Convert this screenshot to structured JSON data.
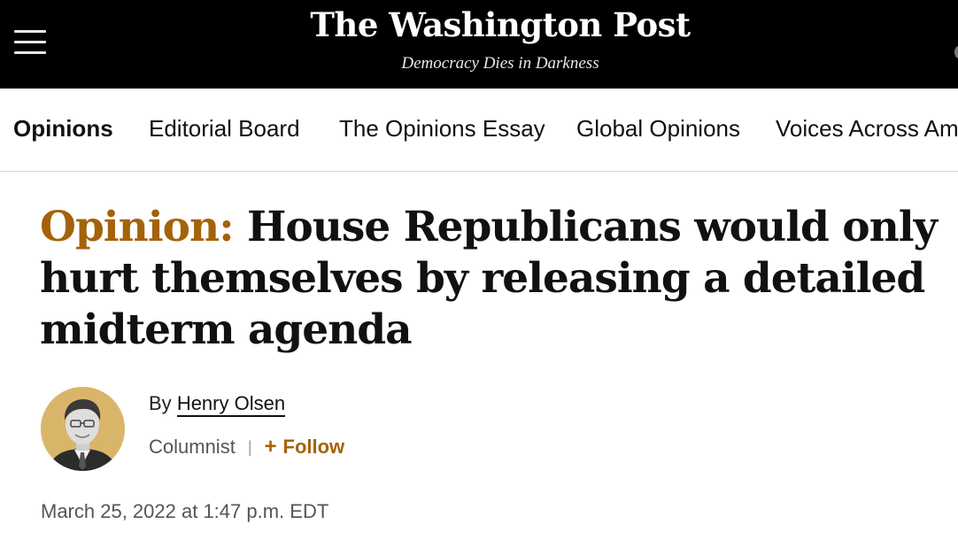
{
  "masthead": {
    "logo_text": "The Washington Post",
    "tagline": "Democracy Dies in Darkness"
  },
  "section_nav": {
    "items": [
      {
        "label": "Opinions",
        "active": true
      },
      {
        "label": "Editorial Board",
        "active": false
      },
      {
        "label": "The Opinions Essay",
        "active": false
      },
      {
        "label": "Global Opinions",
        "active": false
      },
      {
        "label": "Voices Across Am",
        "active": false
      }
    ]
  },
  "article": {
    "kicker": "Opinion:",
    "title": "House Republicans would only hurt themselves by releasing a detailed midterm agenda",
    "byline_prefix": "By",
    "author": "Henry Olsen",
    "author_role": "Columnist",
    "separator": "|",
    "follow_label": "Follow",
    "published": "March 25, 2022 at 1:47 p.m. EDT"
  },
  "colors": {
    "accent": "#a4620a",
    "masthead_bg": "#000000",
    "avatar_bg": "#d9b56a"
  },
  "icons": {
    "menu": "hamburger-menu-icon",
    "follow": "plus-icon"
  }
}
